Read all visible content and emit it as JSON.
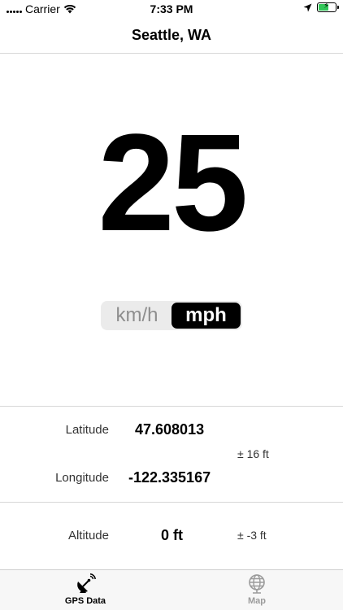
{
  "status_bar": {
    "carrier": "Carrier",
    "time": "7:33 PM",
    "icons": [
      "wifi-icon",
      "location-arrow-icon",
      "battery-charging-icon"
    ]
  },
  "nav": {
    "title": "Seattle, WA"
  },
  "speed": {
    "value": "25"
  },
  "unit_toggle": {
    "options": [
      "km/h",
      "mph"
    ],
    "selected": "mph"
  },
  "gps": {
    "latitude_label": "Latitude",
    "latitude_value": "47.608013",
    "horizontal_accuracy": "± 16 ft",
    "longitude_label": "Longitude",
    "longitude_value": "-122.335167",
    "altitude_label": "Altitude",
    "altitude_value": "0 ft",
    "vertical_accuracy": "± -3 ft"
  },
  "tabs": [
    {
      "label": "GPS Data",
      "icon": "satellite-dish-icon",
      "active": true
    },
    {
      "label": "Map",
      "icon": "globe-icon",
      "active": false
    }
  ],
  "colors": {
    "accent": "#000000",
    "inactive_tab": "#9b9b9b",
    "battery": "#33c759"
  }
}
